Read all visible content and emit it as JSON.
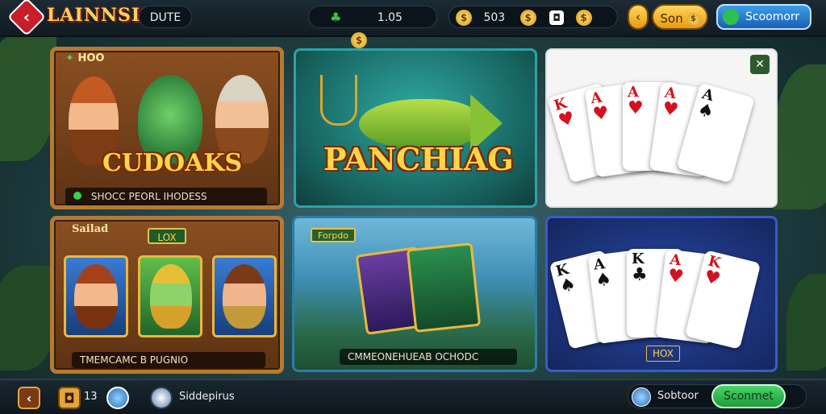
{
  "header": {
    "logo_text": "LAINNSIS",
    "tab_label": "DUTE",
    "currency_1": "1.05",
    "currency_2": "503",
    "coins_button": "Son",
    "store_button": "Scoomorr"
  },
  "tiles": {
    "tile1": {
      "badge": "HOO",
      "title": "CUDOAKS",
      "caption": "SHOCC PEORL IHODESS"
    },
    "tile2": {
      "title": "PANCHIAG"
    },
    "tile3": {
      "corner_icon": "share-icon"
    },
    "tile4": {
      "label": "Sailad",
      "badge": "LOX",
      "caption": "TMEMCAMC B PUGNIO"
    },
    "tile5": {
      "badge": "Forpdo",
      "caption": "CMMEONEHUEAB OCHODC"
    },
    "tile6": {
      "badge": "HOX"
    }
  },
  "cards_tile3": [
    {
      "rank": "K",
      "suit": "♥",
      "color": "red"
    },
    {
      "rank": "A",
      "suit": "♥",
      "color": "red"
    },
    {
      "rank": "A",
      "suit": "♥",
      "color": "red"
    },
    {
      "rank": "A",
      "suit": "♥",
      "color": "red"
    },
    {
      "rank": "A",
      "suit": "♠",
      "color": "black"
    }
  ],
  "cards_tile6": [
    {
      "rank": "K",
      "suit": "♠",
      "color": "black"
    },
    {
      "rank": "A",
      "suit": "♠",
      "color": "black"
    },
    {
      "rank": "K",
      "suit": "♣",
      "color": "black"
    },
    {
      "rank": "A",
      "suit": "♥",
      "color": "red"
    },
    {
      "rank": "K",
      "suit": "♥",
      "color": "red"
    }
  ],
  "footer": {
    "counter": "13",
    "player_label": "Siddepirus",
    "status_label": "Sobtoor",
    "action_button": "Sconmet"
  },
  "colors": {
    "accent_gold": "#ffd44a",
    "wood": "#8a4f22",
    "navy_tile": "#1c2f7a",
    "green_button": "#2fb84f"
  }
}
